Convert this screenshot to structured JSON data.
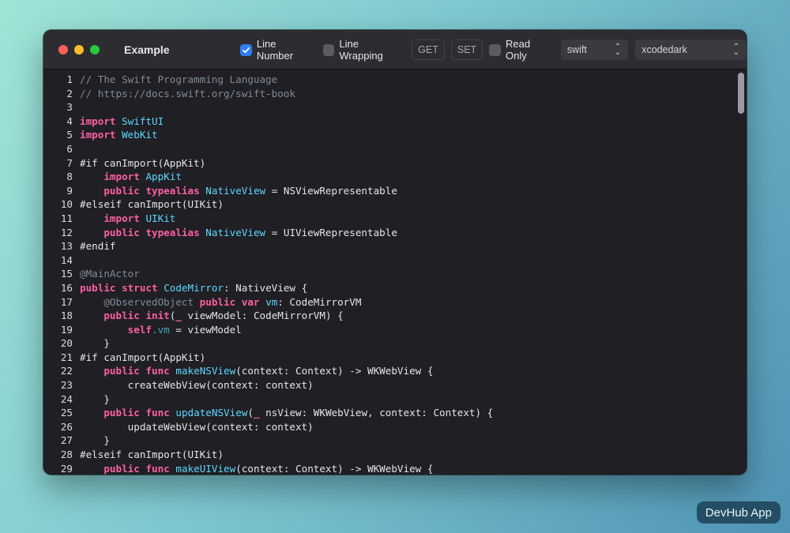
{
  "window": {
    "title": "Example"
  },
  "toolbar": {
    "line_number_label": "Line Number",
    "line_number_checked": true,
    "line_wrapping_label": "Line Wrapping",
    "line_wrapping_checked": false,
    "get_label": "GET",
    "set_label": "SET",
    "read_only_label": "Read Only",
    "read_only_checked": false,
    "language_value": "swift",
    "theme_value": "xcodedark"
  },
  "colors": {
    "accent": "#2f7cf6",
    "keyword": "#fc5fa3",
    "type": "#5dd8ff",
    "comment": "#7f8c98"
  },
  "editor": {
    "lines": [
      [
        [
          "comment",
          "// The Swift Programming Language"
        ]
      ],
      [
        [
          "comment",
          "// https://docs.swift.org/swift-book"
        ]
      ],
      [],
      [
        [
          "kw",
          "import"
        ],
        [
          "plain",
          " "
        ],
        [
          "type",
          "SwiftUI"
        ]
      ],
      [
        [
          "kw",
          "import"
        ],
        [
          "plain",
          " "
        ],
        [
          "type",
          "WebKit"
        ]
      ],
      [],
      [
        [
          "pre",
          "#if canImport(AppKit)"
        ]
      ],
      [
        [
          "plain",
          "    "
        ],
        [
          "kw",
          "import"
        ],
        [
          "plain",
          " "
        ],
        [
          "type",
          "AppKit"
        ]
      ],
      [
        [
          "plain",
          "    "
        ],
        [
          "kw",
          "public"
        ],
        [
          "plain",
          " "
        ],
        [
          "kw",
          "typealias"
        ],
        [
          "plain",
          " "
        ],
        [
          "type",
          "NativeView"
        ],
        [
          "plain",
          " = NSViewRepresentable"
        ]
      ],
      [
        [
          "pre",
          "#elseif canImport(UIKit)"
        ]
      ],
      [
        [
          "plain",
          "    "
        ],
        [
          "kw",
          "import"
        ],
        [
          "plain",
          " "
        ],
        [
          "type",
          "UIKit"
        ]
      ],
      [
        [
          "plain",
          "    "
        ],
        [
          "kw",
          "public"
        ],
        [
          "plain",
          " "
        ],
        [
          "kw",
          "typealias"
        ],
        [
          "plain",
          " "
        ],
        [
          "type",
          "NativeView"
        ],
        [
          "plain",
          " = UIViewRepresentable"
        ]
      ],
      [
        [
          "pre",
          "#endif"
        ]
      ],
      [],
      [
        [
          "attr",
          "@MainActor"
        ]
      ],
      [
        [
          "kw",
          "public"
        ],
        [
          "plain",
          " "
        ],
        [
          "kw",
          "struct"
        ],
        [
          "plain",
          " "
        ],
        [
          "type",
          "CodeMirror"
        ],
        [
          "plain",
          ": NativeView {"
        ]
      ],
      [
        [
          "plain",
          "    "
        ],
        [
          "attr",
          "@ObservedObject"
        ],
        [
          "plain",
          " "
        ],
        [
          "kw",
          "public"
        ],
        [
          "plain",
          " "
        ],
        [
          "kw",
          "var"
        ],
        [
          "plain",
          " "
        ],
        [
          "type",
          "vm"
        ],
        [
          "plain",
          ": CodeMirrorVM"
        ]
      ],
      [
        [
          "plain",
          "    "
        ],
        [
          "kw",
          "public"
        ],
        [
          "plain",
          " "
        ],
        [
          "kw",
          "init"
        ],
        [
          "plain",
          "("
        ],
        [
          "kw",
          "_"
        ],
        [
          "plain",
          " viewModel: CodeMirrorVM) {"
        ]
      ],
      [
        [
          "plain",
          "        "
        ],
        [
          "kw",
          "self"
        ],
        [
          "prop",
          ".vm"
        ],
        [
          "plain",
          " = viewModel"
        ]
      ],
      [
        [
          "plain",
          "    }"
        ]
      ],
      [
        [
          "pre",
          "#if canImport(AppKit)"
        ]
      ],
      [
        [
          "plain",
          "    "
        ],
        [
          "kw",
          "public"
        ],
        [
          "plain",
          " "
        ],
        [
          "kw",
          "func"
        ],
        [
          "plain",
          " "
        ],
        [
          "type",
          "makeNSView"
        ],
        [
          "plain",
          "(context: Context) -> WKWebView {"
        ]
      ],
      [
        [
          "plain",
          "        createWebView(context: context)"
        ]
      ],
      [
        [
          "plain",
          "    }"
        ]
      ],
      [
        [
          "plain",
          "    "
        ],
        [
          "kw",
          "public"
        ],
        [
          "plain",
          " "
        ],
        [
          "kw",
          "func"
        ],
        [
          "plain",
          " "
        ],
        [
          "type",
          "updateNSView"
        ],
        [
          "plain",
          "("
        ],
        [
          "kw",
          "_"
        ],
        [
          "plain",
          " nsView: WKWebView, context: Context) {"
        ]
      ],
      [
        [
          "plain",
          "        updateWebView(context: context)"
        ]
      ],
      [
        [
          "plain",
          "    }"
        ]
      ],
      [
        [
          "pre",
          "#elseif canImport(UIKit)"
        ]
      ],
      [
        [
          "plain",
          "    "
        ],
        [
          "kw",
          "public"
        ],
        [
          "plain",
          " "
        ],
        [
          "kw",
          "func"
        ],
        [
          "plain",
          " "
        ],
        [
          "type",
          "makeUIView"
        ],
        [
          "plain",
          "(context: Context) -> WKWebView {"
        ]
      ]
    ],
    "line_numbers": [
      "1",
      "2",
      "3",
      "4",
      "5",
      "6",
      "7",
      "8",
      "9",
      "10",
      "11",
      "12",
      "13",
      "14",
      "15",
      "16",
      "17",
      "18",
      "19",
      "20",
      "21",
      "22",
      "23",
      "24",
      "25",
      "26",
      "27",
      "28",
      "29"
    ]
  },
  "badge": {
    "label": "DevHub App"
  }
}
